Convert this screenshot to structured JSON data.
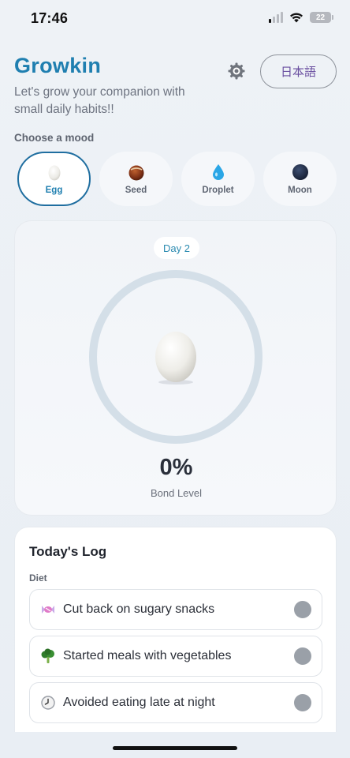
{
  "status": {
    "time": "17:46",
    "battery": "22"
  },
  "header": {
    "title": "Growkin",
    "subtitle": "Let's grow your companion with small daily habits!!",
    "language_button": "日本語"
  },
  "mood": {
    "label": "Choose a mood",
    "selected": "Egg",
    "options": [
      {
        "label": "Egg",
        "icon": "egg-icon"
      },
      {
        "label": "Seed",
        "icon": "seed-icon"
      },
      {
        "label": "Droplet",
        "icon": "droplet-icon"
      },
      {
        "label": "Moon",
        "icon": "moon-icon"
      }
    ]
  },
  "companion": {
    "day": "Day 2",
    "bond_percent": "0%",
    "bond_fraction": 0,
    "bond_label": "Bond Level"
  },
  "log": {
    "title": "Today's Log",
    "category": "Diet",
    "items": [
      {
        "text": "Cut back on sugary snacks",
        "icon": "candy-icon",
        "done": false
      },
      {
        "text": "Started meals with vegetables",
        "icon": "broccoli-icon",
        "done": false
      },
      {
        "text": "Avoided eating late at night",
        "icon": "clock-icon",
        "done": false
      }
    ]
  },
  "colors": {
    "accent": "#1f7fb0",
    "ring": "#d4dfe8",
    "toggle_off": "#9aa0a8"
  }
}
